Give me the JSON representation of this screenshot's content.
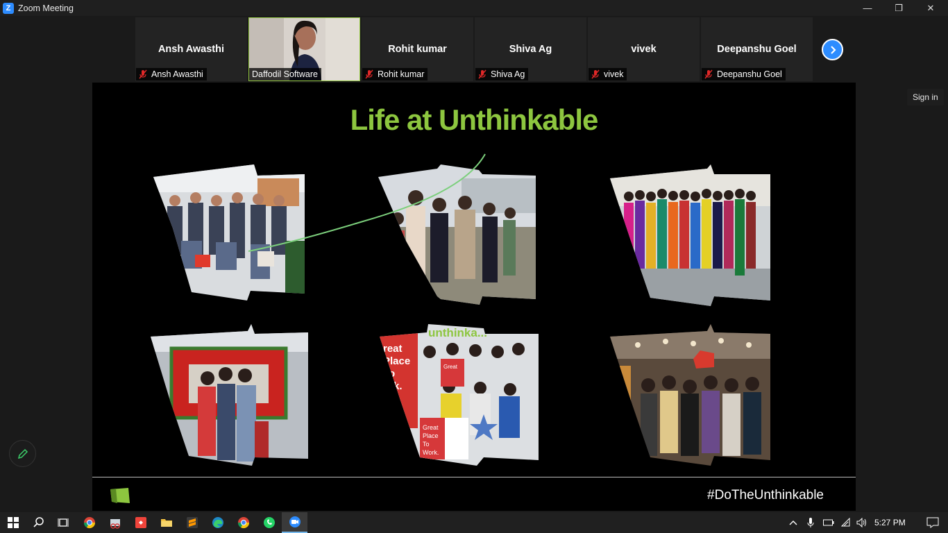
{
  "window": {
    "title": "Zoom Meeting",
    "minimize": "—",
    "restore": "❐",
    "close": "✕"
  },
  "participants": [
    {
      "name": "Ansh Awasthi",
      "caption": "Ansh Awasthi",
      "muted": true
    },
    {
      "name": "Daffodil Software",
      "caption": "Daffodil Software",
      "muted": false,
      "video": true
    },
    {
      "name": "Rohit kumar",
      "caption": "Rohit kumar",
      "muted": true
    },
    {
      "name": "Shiva Ag",
      "caption": "Shiva Ag",
      "muted": true
    },
    {
      "name": "vivek",
      "caption": "vivek",
      "muted": true
    },
    {
      "name": "Deepanshu Goel",
      "caption": "Deepanshu Goel",
      "muted": true
    }
  ],
  "sign_in": "Sign in",
  "slide": {
    "title": "Life at Unthinkable",
    "hashtag": "#DoTheUnthinkable",
    "photo_labels": {
      "great_place_1": "Great Place To Work.",
      "great_place_2": "Great Place To Work.",
      "unthinkable_banner": "unthinka...",
      "great_place_side": "reat Place To ork."
    }
  },
  "taskbar": {
    "time": "5:27 PM",
    "apps": [
      "start",
      "search",
      "task-view",
      "chrome",
      "snipping",
      "anydesk",
      "file-explorer",
      "sublime",
      "edge",
      "chrome-2",
      "whatsapp",
      "zoom"
    ]
  },
  "colors": {
    "accent_green": "#8dc63f",
    "zoom_blue": "#2d8cff",
    "muted_red": "#e02828"
  }
}
